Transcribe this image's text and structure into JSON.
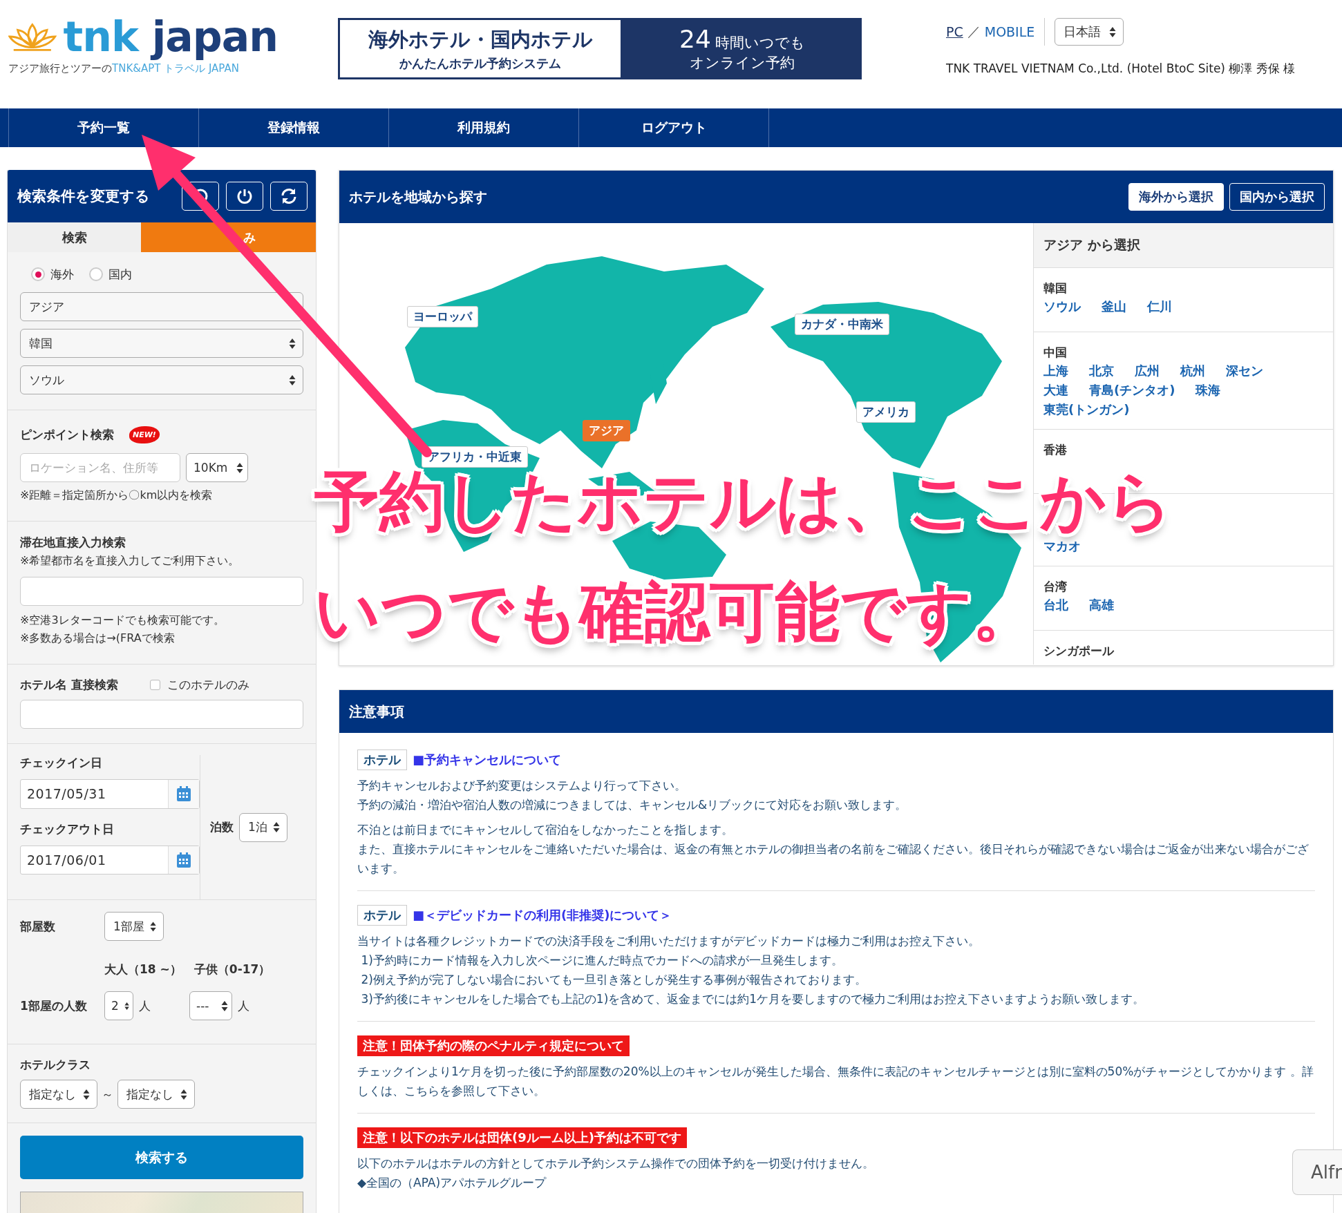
{
  "header": {
    "logo": {
      "brand_left": "tnk",
      "brand_right": "japan",
      "tagline_lead": "アジア旅行とツアーの",
      "tagline_brand": "TNK&APT トラベル JAPAN"
    },
    "banner": {
      "title": "海外ホテル・国内ホテル",
      "subtitle": "かんたんホテル予約システム",
      "hours": "24",
      "hours_text": "時間いつでも",
      "online": "オンライン予約"
    },
    "device_links": [
      {
        "label": "PC",
        "selected": true
      },
      {
        "label": "MOBILE",
        "selected": false
      }
    ],
    "device_separator": "／",
    "language": "日本語",
    "account": "TNK TRAVEL VIETNAM Co.,Ltd. (Hotel BtoC Site) 柳澤 秀保 様"
  },
  "nav": [
    {
      "label": "予約一覧"
    },
    {
      "label": "登録情報"
    },
    {
      "label": "利用規約"
    },
    {
      "label": "ログアウト"
    }
  ],
  "sidebar": {
    "title": "検索条件を変更する",
    "tabs": [
      {
        "label": "検索",
        "selected": true
      },
      {
        "label": "み",
        "selected": false
      }
    ],
    "destination": {
      "options": [
        {
          "label": "海外",
          "selected": true
        },
        {
          "label": "国内",
          "selected": false
        }
      ],
      "region": "アジア",
      "country": "韓国",
      "city": "ソウル"
    },
    "pinpoint": {
      "label": "ピンポイント検索",
      "badge": "NEW!",
      "placeholder": "ロケーション名、住所等",
      "distance": "10Km",
      "note": "※距離＝指定箇所から〇km以内を検索"
    },
    "direct_city": {
      "label": "滞在地直接入力検索",
      "hint": "※希望都市名を直接入力してご利用下さい。",
      "notes": [
        "※空港3レターコードでも検索可能です。",
        "※多数ある場合は→(FRAで検索"
      ]
    },
    "hotel_name": {
      "label": "ホテル名 直接検索",
      "only_label": "このホテルのみ",
      "only_checked": false
    },
    "dates": {
      "checkin_label": "チェックイン日",
      "checkin": "2017/05/31",
      "checkout_label": "チェックアウト日",
      "checkout": "2017/06/01",
      "nights_label": "泊数",
      "nights": "1泊"
    },
    "rooms": {
      "label": "部屋数",
      "value": "1部屋",
      "adults_label": "大人（18 ~）",
      "children_label": "子供（0-17）",
      "per_room_label": "1部屋の人数",
      "adults": "2",
      "adult_unit": "人",
      "children": "---",
      "child_unit": "人"
    },
    "hotel_class": {
      "label": "ホテルクラス",
      "from": "指定なし",
      "separator": "～",
      "to": "指定なし"
    },
    "search_button": "検索する"
  },
  "map_panel": {
    "title": "ホテルを地域から探す",
    "buttons": [
      {
        "label": "海外から選択",
        "selected": true
      },
      {
        "label": "国内から選択",
        "selected": false
      }
    ],
    "regions": [
      {
        "label": "ヨーロッパ",
        "selected": false
      },
      {
        "label": "カナダ・中南米",
        "selected": false
      },
      {
        "label": "アメリカ",
        "selected": false
      },
      {
        "label": "アジア",
        "selected": true
      },
      {
        "label": "アフリカ・中近東",
        "selected": false
      }
    ],
    "list_title": "アジア から選択",
    "groups": [
      {
        "name": "韓国",
        "cities": [
          "ソウル",
          "釜山",
          "仁川"
        ]
      },
      {
        "name": "中国",
        "cities": [
          "上海",
          "北京",
          "広州",
          "杭州",
          "深セン",
          "大連",
          "青島(チンタオ)",
          "珠海",
          "東莞(トンガン)"
        ]
      },
      {
        "name": "香港"
      },
      {
        "cities": [
          "マカオ"
        ]
      },
      {
        "name": "台湾",
        "cities": [
          "台北",
          "高雄"
        ]
      },
      {
        "name": "シンガポール"
      }
    ]
  },
  "notices": {
    "title": "注意事項",
    "items": [
      {
        "kind": "hotel",
        "tag": "ホテル",
        "title": "■予約キャンセルについて",
        "blocks": [
          [
            "予約キャンセルおよび予約変更はシステムより行って下さい。",
            "予約の減泊・増泊や宿泊人数の増減につきましては、キャンセル&リブックにて対応をお願い致します。"
          ],
          [
            "不泊とは前日までにキャンセルして宿泊をしなかったことを指します。",
            "また、直接ホテルにキャンセルをご連絡いただいた場合は、返金の有無とホテルの御担当者の名前をご確認ください。後日それらが確認できない場合はご返金が出来ない場合がございます。"
          ]
        ]
      },
      {
        "kind": "hotel",
        "tag": "ホテル",
        "title": "■＜デビッドカードの利用(非推奨)について＞",
        "blocks": [
          [
            "当サイトは各種クレジットカードでの決済手段をご利用いただけますがデビッドカードは極力ご利用はお控え下さい。",
            " 1)予約時にカード情報を入力し次ページに進んだ時点でカードへの請求が一旦発生します。",
            " 2)例え予約が完了しない場合においても一旦引き落としが発生する事例が報告されております。",
            " 3)予約後にキャンセルをした場合でも上記の1)を含めて、返金までには約1ケ月を要しますので極力ご利用はお控え下さいますようお願い致します。"
          ]
        ]
      },
      {
        "kind": "warning",
        "title": "注意！団体予約の際のペナルティ規定について",
        "blocks": [
          [
            "チェックインより1ケ月を切った後に予約部屋数の20%以上のキャンセルが発生した場合、無条件に表記のキャンセルチャージとは別に室料の50%がチャージとしてかかります 。詳しくは、こちらを参照して下さい。"
          ]
        ]
      },
      {
        "kind": "warning",
        "title": "注意！以下のホテルは団体(9ルーム以上)予約は不可です",
        "blocks": [
          [
            "以下のホテルはホテルの方針としてホテル予約システム操作での団体予約を一切受け付けません。",
            "◆全国の（APA)アパホテルグループ"
          ]
        ]
      }
    ]
  },
  "annotation": {
    "lines": [
      "予約したホテルは、ここから",
      "いつでも確認可能です。"
    ]
  },
  "popup": {
    "label": "Alfr"
  }
}
